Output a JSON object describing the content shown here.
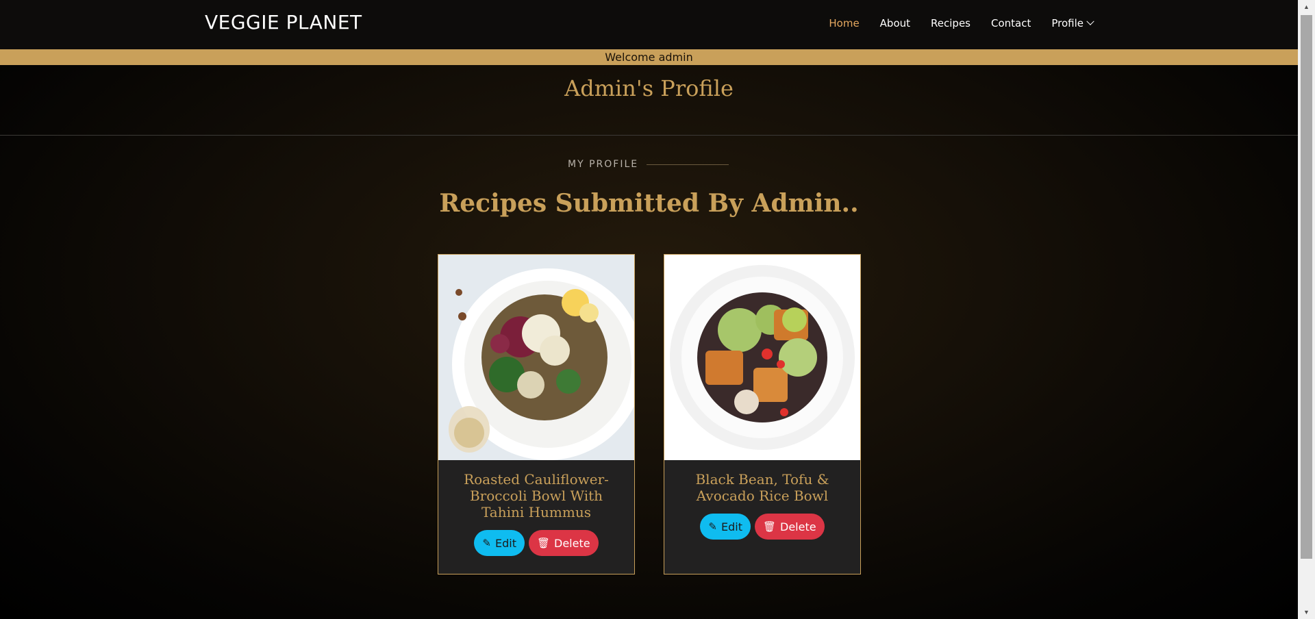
{
  "brand": "VEGGIE PLANET",
  "nav": {
    "home": "Home",
    "about": "About",
    "recipes": "Recipes",
    "contact": "Contact",
    "profile": "Profile"
  },
  "welcome": "Welcome admin",
  "profile_title": "Admin's Profile",
  "subtitle": "MY PROFILE",
  "section_title": "Recipes Submitted By Admin..",
  "recipes": [
    {
      "title": "Roasted Cauliflower-Broccoli Bowl With Tahini Hummus",
      "edit": "Edit",
      "delete": "Delete"
    },
    {
      "title": "Black Bean, Tofu & Avocado Rice Bowl",
      "edit": "Edit",
      "delete": "Delete"
    }
  ],
  "colors": {
    "accent": "#c9a05a",
    "nav_active": "#e5a860",
    "edit": "#0fbcf0",
    "delete": "#dc3545"
  }
}
